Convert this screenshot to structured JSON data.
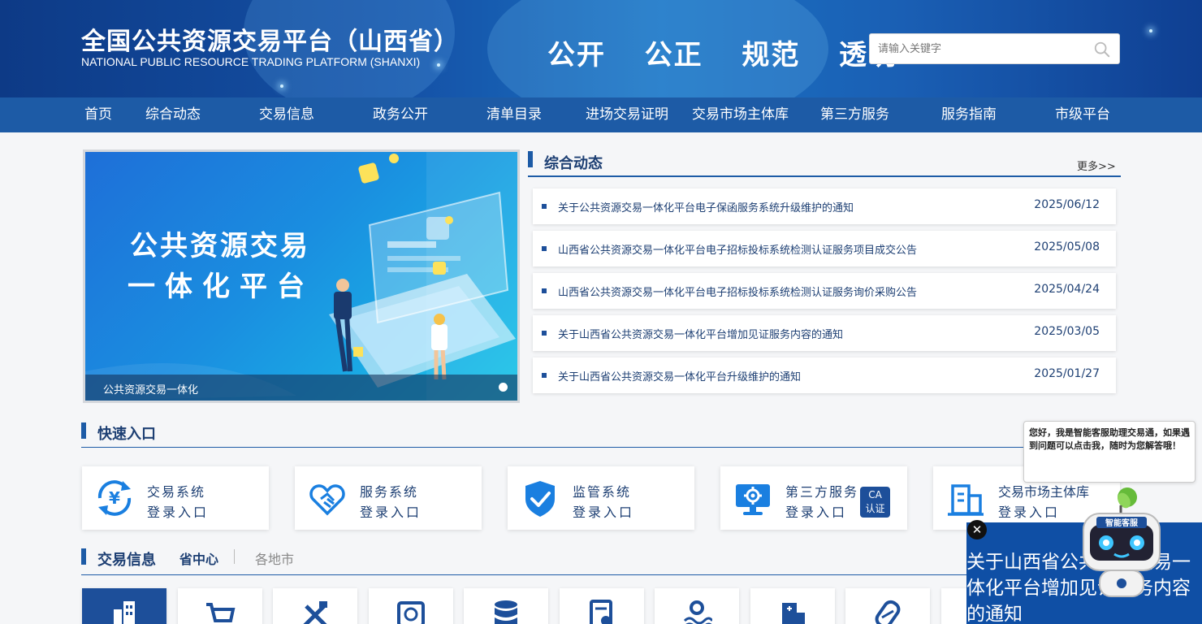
{
  "header": {
    "title": "全国公共资源交易平台（山西省）",
    "subtitle": "NATIONAL PUBLIC RESOURCE TRADING PLATFORM (SHANXI)",
    "slogan": "公开  公正  规范  透明",
    "search_placeholder": "请输入关键字"
  },
  "nav": {
    "items": [
      "首页",
      "综合动态",
      "交易信息",
      "政务公开",
      "清单目录",
      "进场交易证明",
      "交易市场主体库",
      "第三方服务",
      "服务指南",
      "市级平台"
    ]
  },
  "banner": {
    "line1": "公共资源交易",
    "line2": "一体化平台",
    "caption": "公共资源交易一体化"
  },
  "news": {
    "title": "综合动态",
    "more": "更多>>",
    "items": [
      {
        "text": "关于公共资源交易一体化平台电子保函服务系统升级维护的通知",
        "date": "2025/06/12"
      },
      {
        "text": "山西省公共资源交易一体化平台电子招标投标系统检测认证服务项目成交公告",
        "date": "2025/05/08"
      },
      {
        "text": "山西省公共资源交易一体化平台电子招标投标系统检测认证服务询价采购公告",
        "date": "2025/04/24"
      },
      {
        "text": "关于山西省公共资源交易一体化平台增加见证服务内容的通知",
        "date": "2025/03/05"
      },
      {
        "text": "关于山西省公共资源交易一体化平台升级维护的通知",
        "date": "2025/01/27"
      }
    ]
  },
  "quick_entry": {
    "title": "快速入口",
    "cards": [
      {
        "line1": "交易系统",
        "line2": "登录入口",
        "icon": "yuan-refresh-icon"
      },
      {
        "line1": "服务系统",
        "line2": "登录入口",
        "icon": "handshake-icon"
      },
      {
        "line1": "监管系统",
        "line2": "登录入口",
        "icon": "shield-check-icon"
      },
      {
        "line1": "第三方服务",
        "line2": "登录入口",
        "icon": "monitor-gear-icon",
        "badge_line1": "CA",
        "badge_line2": "认证"
      },
      {
        "line1": "交易市场主体库",
        "line2": "登录入口",
        "icon": "building-icon"
      }
    ]
  },
  "trade_info": {
    "title": "交易信息",
    "tab_active": "省中心",
    "tab_inactive": "各地市",
    "icons": [
      "buildings-icon",
      "cart-icon",
      "tools-icon",
      "land-icon",
      "database-icon",
      "document-icon",
      "mining-icon",
      "hospital-icon",
      "medicine-icon",
      "more-icon"
    ]
  },
  "chat": {
    "bubble": "您好，我是智能客服助理交易通，如果遇到问题可以点击我，随时为您解答哦！",
    "robot_label": "智能客服"
  },
  "popup": {
    "text": "关于山西省公共资源交易一体化平台增加见证服务内容的通知",
    "close": "✕"
  },
  "colors": {
    "primary": "#1d5ba6",
    "dark_text": "#1d3f73",
    "accent_blue": "#1a7fe0"
  }
}
